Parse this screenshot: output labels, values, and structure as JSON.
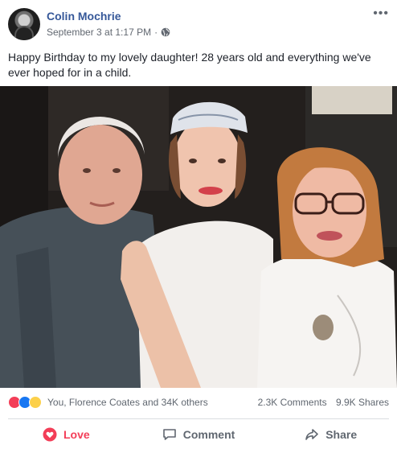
{
  "post": {
    "author": "Colin Mochrie",
    "timestamp": "September 3 at 1:17 PM",
    "separator": "·",
    "privacy_icon": "globe-icon",
    "more_icon": "more-options-icon",
    "body": "Happy Birthday to my lovely daughter! 28 years old and everything we've ever hoped for in a child.",
    "photo_description_icon": "photo"
  },
  "reactions": {
    "icons": [
      "love-reaction-icon",
      "like-reaction-icon",
      "wow-reaction-icon"
    ],
    "summary": "You, Florence Coates and 34K others",
    "comments": "2.3K Comments",
    "shares": "9.9K Shares"
  },
  "actions": {
    "love_label": "Love",
    "comment_label": "Comment",
    "share_label": "Share"
  },
  "colors": {
    "author": "#365899",
    "love": "#f33e58",
    "like": "#1877f2",
    "wow": "#fcd04a",
    "muted": "#606770"
  }
}
